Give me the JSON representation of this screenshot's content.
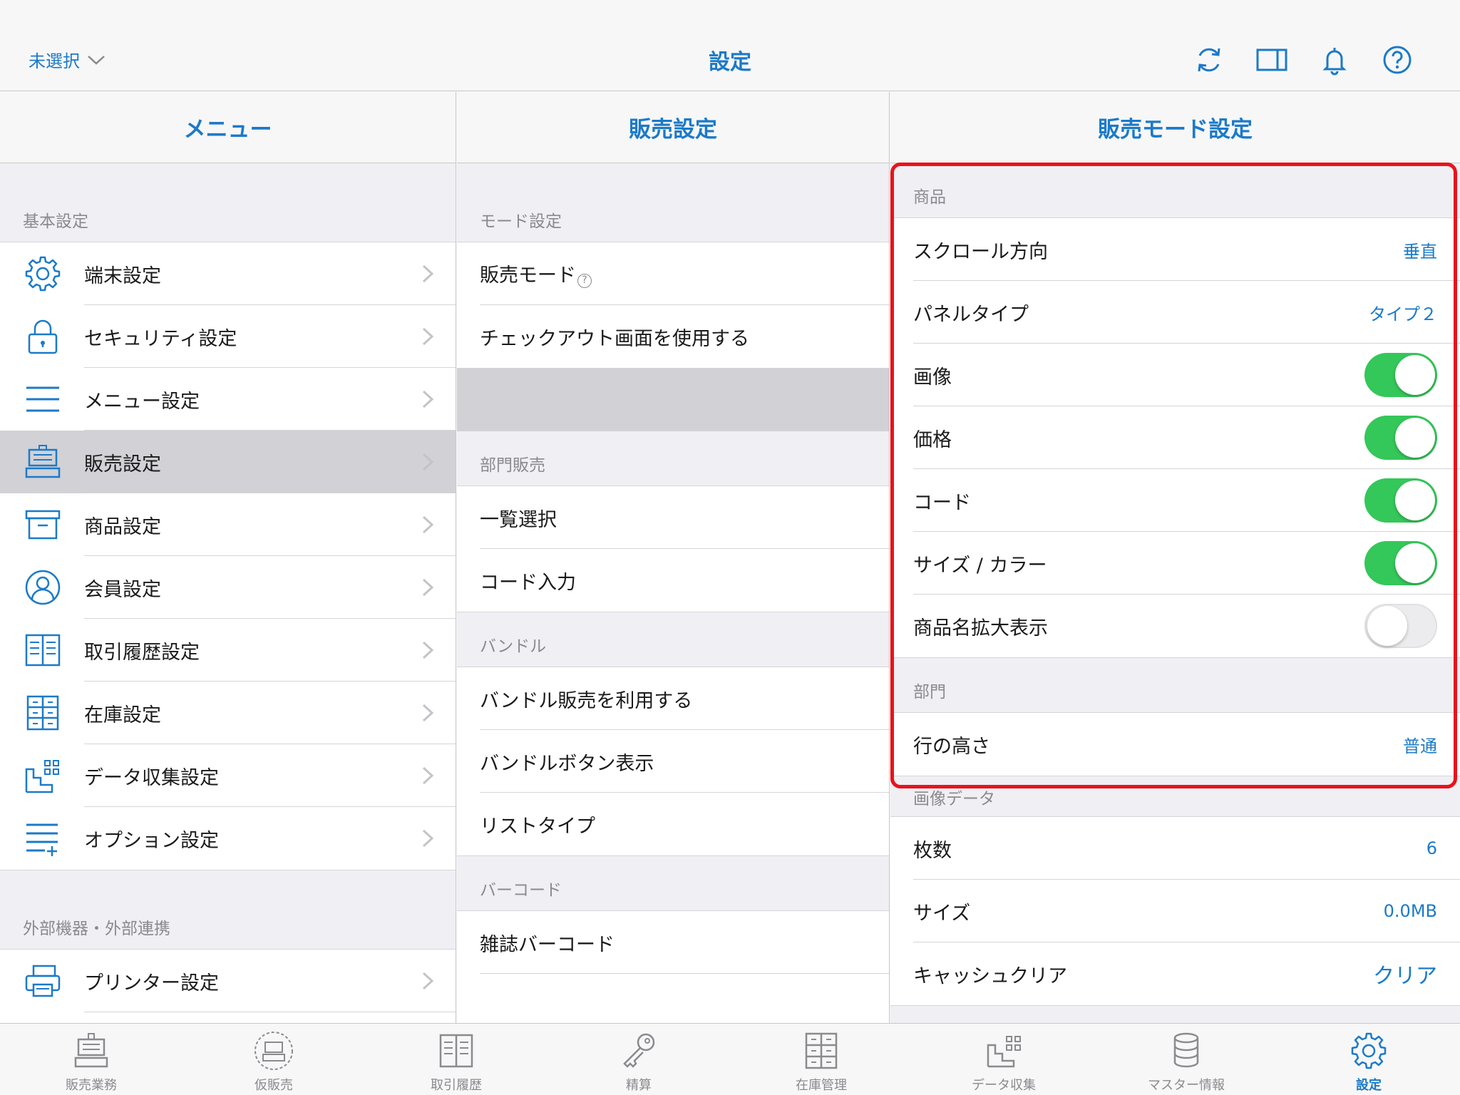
{
  "topbar": {
    "store_selector": "未選択",
    "title": "設定",
    "icons": [
      "refresh-icon",
      "split-view-icon",
      "bell-icon",
      "help-icon"
    ]
  },
  "menu": {
    "title": "メニュー",
    "section_basic": "基本設定",
    "items": [
      {
        "label": "端末設定",
        "icon": "gear-icon"
      },
      {
        "label": "セキュリティ設定",
        "icon": "lock-icon"
      },
      {
        "label": "メニュー設定",
        "icon": "hamburger-icon"
      },
      {
        "label": "販売設定",
        "icon": "register-icon"
      },
      {
        "label": "商品設定",
        "icon": "box-icon"
      },
      {
        "label": "会員設定",
        "icon": "person-icon"
      },
      {
        "label": "取引履歴設定",
        "icon": "book-icon"
      },
      {
        "label": "在庫設定",
        "icon": "cabinet-icon"
      },
      {
        "label": "データ収集設定",
        "icon": "data-icon"
      },
      {
        "label": "オプション設定",
        "icon": "list-plus-icon"
      }
    ],
    "section_external": "外部機器・外部連携",
    "external_items": [
      {
        "label": "プリンター設定",
        "icon": "printer-icon"
      }
    ]
  },
  "sales": {
    "title": "販売設定",
    "sections": {
      "mode": "モード設定",
      "dept": "部門販売",
      "bundle": "バンドル",
      "barcode": "バーコード"
    },
    "mode_items": [
      "販売モード",
      "チェックアウト画面を使用する"
    ],
    "dept_items": [
      "一覧選択",
      "コード入力"
    ],
    "bundle_items": [
      "バンドル販売を利用する",
      "バンドルボタン表示",
      "リストタイプ"
    ],
    "barcode_items": [
      "雑誌バーコード"
    ],
    "help_glyph": "?"
  },
  "mode_settings": {
    "title": "販売モード設定",
    "section_product": "商品",
    "scroll_label": "スクロール方向",
    "scroll_value": "垂直",
    "panel_label": "パネルタイプ",
    "panel_value": "タイプ２",
    "image_label": "画像",
    "image_on": true,
    "price_label": "価格",
    "price_on": true,
    "code_label": "コード",
    "code_on": true,
    "size_color_label": "サイズ / カラー",
    "size_color_on": true,
    "name_zoom_label": "商品名拡大表示",
    "name_zoom_on": false,
    "section_dept": "部門",
    "row_height_label": "行の高さ",
    "row_height_value": "普通",
    "section_image_data": "画像データ",
    "count_label": "枚数",
    "count_value": "6",
    "size_label": "サイズ",
    "size_value": "0.0MB",
    "cache_label": "キャッシュクリア",
    "cache_value": "クリア"
  },
  "tabbar": {
    "tabs": [
      {
        "label": "販売業務",
        "icon": "register-icon"
      },
      {
        "label": "仮販売",
        "icon": "temp-register-icon"
      },
      {
        "label": "取引履歴",
        "icon": "book-icon"
      },
      {
        "label": "精算",
        "icon": "key-icon"
      },
      {
        "label": "在庫管理",
        "icon": "cabinet-icon"
      },
      {
        "label": "データ収集",
        "icon": "data-icon"
      },
      {
        "label": "マスター情報",
        "icon": "database-icon"
      },
      {
        "label": "設定",
        "icon": "gear-icon"
      }
    ],
    "active": "設定"
  },
  "colors": {
    "accent": "#1b7ac9",
    "toggle_on": "#34c759",
    "highlight": "#e8131b"
  }
}
